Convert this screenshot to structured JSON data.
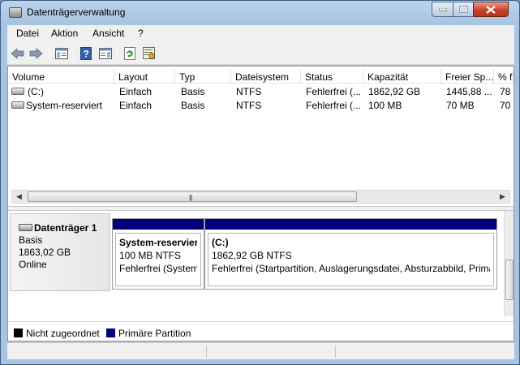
{
  "window": {
    "title": "Datenträgerverwaltung"
  },
  "menu": {
    "items": [
      "Datei",
      "Aktion",
      "Ansicht",
      "?"
    ]
  },
  "toolbar": {
    "icons": [
      "back-arrow-icon",
      "forward-arrow-icon",
      "show-hide-console-tree-icon",
      "help-icon",
      "show-action-pane-icon",
      "refresh-icon",
      "properties-icon"
    ]
  },
  "volume_list": {
    "columns": [
      "Volume",
      "Layout",
      "Typ",
      "Dateisystem",
      "Status",
      "Kapazität",
      "Freier Sp...",
      "% f"
    ],
    "rows": [
      {
        "volume": "(C:)",
        "layout": "Einfach",
        "typ": "Basis",
        "dateisystem": "NTFS",
        "status": "Fehlerfrei (...",
        "kapazitaet": "1862,92 GB",
        "frei": "1445,88 ...",
        "prozent": "78"
      },
      {
        "volume": "System-reserviert",
        "layout": "Einfach",
        "typ": "Basis",
        "dateisystem": "NTFS",
        "status": "Fehlerfrei (...",
        "kapazitaet": "100 MB",
        "frei": "70 MB",
        "prozent": "70"
      }
    ]
  },
  "disk": {
    "name": "Datenträger 1",
    "type": "Basis",
    "size": "1863,02 GB",
    "state": "Online",
    "partitions": [
      {
        "name": "System-reserviert",
        "size_fs": "100 MB NTFS",
        "status": "Fehlerfrei (System,"
      },
      {
        "name": "(C:)",
        "size_fs": "1862,92 GB NTFS",
        "status": "Fehlerfrei (Startpartition, Auslagerungsdatei, Absturzabbild, Primä"
      }
    ]
  },
  "legend": {
    "items": [
      {
        "label": "Nicht zugeordnet",
        "color": "#000000"
      },
      {
        "label": "Primäre Partition",
        "color": "#00007f"
      }
    ]
  },
  "colors": {
    "primary_partition": "#00007f",
    "unallocated": "#000000"
  }
}
